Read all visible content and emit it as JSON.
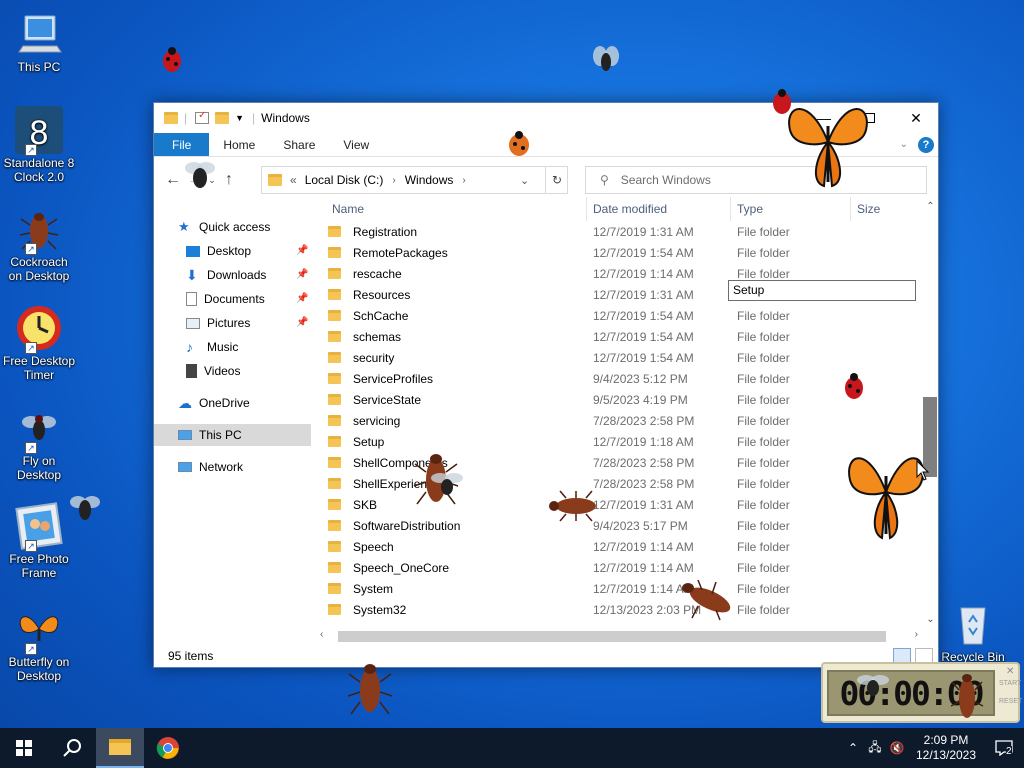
{
  "desktop": {
    "icons": [
      {
        "label": "This PC",
        "icon": "computer-icon"
      },
      {
        "label": "Standalone 8 Clock 2.0",
        "icon": "clock-8-icon"
      },
      {
        "label": "Cockroach on Desktop",
        "icon": "cockroach-icon"
      },
      {
        "label": "Free Desktop Timer",
        "icon": "timer-icon"
      },
      {
        "label": "Fly on Desktop",
        "icon": "fly-icon"
      },
      {
        "label": "Free Photo Frame",
        "icon": "photo-frame-icon"
      },
      {
        "label": "Butterfly on Desktop",
        "icon": "butterfly-icon"
      },
      {
        "label": "Recycle Bin",
        "icon": "recycle-bin-icon"
      }
    ]
  },
  "explorer": {
    "title": "Windows",
    "ribbon": {
      "tabs": [
        "File",
        "Home",
        "Share",
        "View"
      ]
    },
    "address": {
      "prefix": "«",
      "segments": [
        "Local Disk (C:)",
        "Windows"
      ]
    },
    "search": {
      "placeholder": "Search Windows"
    },
    "nav": {
      "quick_access": "Quick access",
      "items": [
        "Desktop",
        "Downloads",
        "Documents",
        "Pictures",
        "Music",
        "Videos"
      ],
      "onedrive": "OneDrive",
      "this_pc": "This PC",
      "network": "Network"
    },
    "columns": {
      "name": "Name",
      "date": "Date modified",
      "type": "Type",
      "size": "Size"
    },
    "rows": [
      {
        "name": "Registration",
        "date": "12/7/2019 1:31 AM",
        "type": "File folder"
      },
      {
        "name": "RemotePackages",
        "date": "12/7/2019 1:54 AM",
        "type": "File folder"
      },
      {
        "name": "rescache",
        "date": "12/7/2019 1:14 AM",
        "type": "File folder"
      },
      {
        "name": "Resources",
        "date": "12/7/2019 1:31 AM",
        "type": ""
      },
      {
        "name": "SchCache",
        "date": "12/7/2019 1:54 AM",
        "type": "File folder"
      },
      {
        "name": "schemas",
        "date": "12/7/2019 1:54 AM",
        "type": "File folder"
      },
      {
        "name": "security",
        "date": "12/7/2019 1:54 AM",
        "type": "File folder"
      },
      {
        "name": "ServiceProfiles",
        "date": "9/4/2023 5:12 PM",
        "type": "File folder"
      },
      {
        "name": "ServiceState",
        "date": "9/5/2023 4:19 PM",
        "type": "File folder"
      },
      {
        "name": "servicing",
        "date": "7/28/2023 2:58 PM",
        "type": "File folder"
      },
      {
        "name": "Setup",
        "date": "12/7/2019 1:18 AM",
        "type": "File folder"
      },
      {
        "name": "ShellComponents",
        "date": "7/28/2023 2:58 PM",
        "type": "File folder"
      },
      {
        "name": "ShellExperiences",
        "date": "7/28/2023 2:58 PM",
        "type": "File folder"
      },
      {
        "name": "SKB",
        "date": "12/7/2019 1:31 AM",
        "type": "File folder"
      },
      {
        "name": "SoftwareDistribution",
        "date": "9/4/2023 5:17 PM",
        "type": "File folder"
      },
      {
        "name": "Speech",
        "date": "12/7/2019 1:14 AM",
        "type": "File folder"
      },
      {
        "name": "Speech_OneCore",
        "date": "12/7/2019 1:14 AM",
        "type": "File folder"
      },
      {
        "name": "System",
        "date": "12/7/2019 1:14 AM",
        "type": "File folder"
      },
      {
        "name": "System32",
        "date": "12/13/2023 2:03 PM",
        "type": "File folder"
      }
    ],
    "rename_value": "Setup",
    "status": "95 items"
  },
  "timer": {
    "display": "00:00:00",
    "side_top": "START",
    "side_bottom": "RESET"
  },
  "taskbar": {
    "time": "2:09 PM",
    "date": "12/13/2023",
    "notifications": "2",
    "apps": [
      "start-icon",
      "search-icon",
      "file-explorer-icon",
      "chrome-icon"
    ]
  },
  "colors": {
    "desktop": "#1671dc",
    "accent": "#1979ca",
    "taskbar": "#0d1a2b",
    "folder": "#f4c555"
  }
}
